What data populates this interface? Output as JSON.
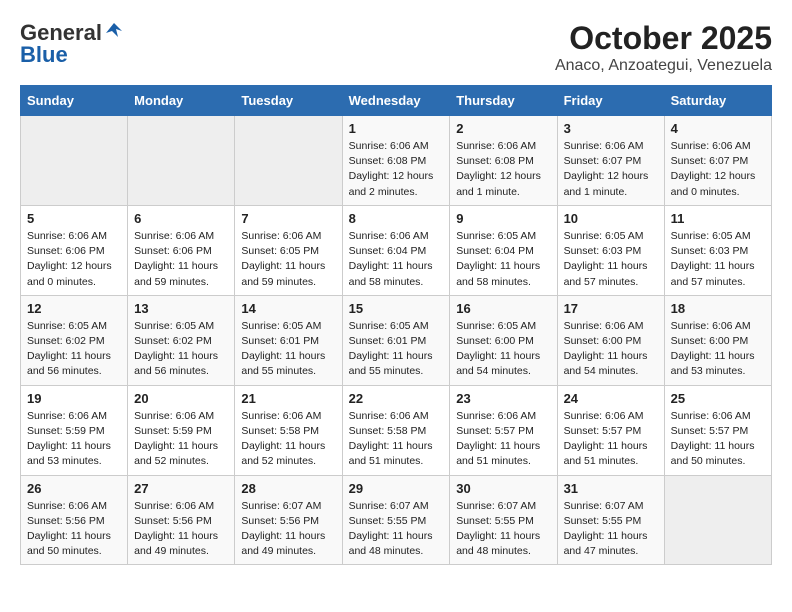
{
  "header": {
    "logo_general": "General",
    "logo_blue": "Blue",
    "title": "October 2025",
    "subtitle": "Anaco, Anzoategui, Venezuela"
  },
  "weekdays": [
    "Sunday",
    "Monday",
    "Tuesday",
    "Wednesday",
    "Thursday",
    "Friday",
    "Saturday"
  ],
  "weeks": [
    [
      {
        "day": "",
        "sunrise": "",
        "sunset": "",
        "daylight": ""
      },
      {
        "day": "",
        "sunrise": "",
        "sunset": "",
        "daylight": ""
      },
      {
        "day": "",
        "sunrise": "",
        "sunset": "",
        "daylight": ""
      },
      {
        "day": "1",
        "sunrise": "Sunrise: 6:06 AM",
        "sunset": "Sunset: 6:08 PM",
        "daylight": "Daylight: 12 hours and 2 minutes."
      },
      {
        "day": "2",
        "sunrise": "Sunrise: 6:06 AM",
        "sunset": "Sunset: 6:08 PM",
        "daylight": "Daylight: 12 hours and 1 minute."
      },
      {
        "day": "3",
        "sunrise": "Sunrise: 6:06 AM",
        "sunset": "Sunset: 6:07 PM",
        "daylight": "Daylight: 12 hours and 1 minute."
      },
      {
        "day": "4",
        "sunrise": "Sunrise: 6:06 AM",
        "sunset": "Sunset: 6:07 PM",
        "daylight": "Daylight: 12 hours and 0 minutes."
      }
    ],
    [
      {
        "day": "5",
        "sunrise": "Sunrise: 6:06 AM",
        "sunset": "Sunset: 6:06 PM",
        "daylight": "Daylight: 12 hours and 0 minutes."
      },
      {
        "day": "6",
        "sunrise": "Sunrise: 6:06 AM",
        "sunset": "Sunset: 6:06 PM",
        "daylight": "Daylight: 11 hours and 59 minutes."
      },
      {
        "day": "7",
        "sunrise": "Sunrise: 6:06 AM",
        "sunset": "Sunset: 6:05 PM",
        "daylight": "Daylight: 11 hours and 59 minutes."
      },
      {
        "day": "8",
        "sunrise": "Sunrise: 6:06 AM",
        "sunset": "Sunset: 6:04 PM",
        "daylight": "Daylight: 11 hours and 58 minutes."
      },
      {
        "day": "9",
        "sunrise": "Sunrise: 6:05 AM",
        "sunset": "Sunset: 6:04 PM",
        "daylight": "Daylight: 11 hours and 58 minutes."
      },
      {
        "day": "10",
        "sunrise": "Sunrise: 6:05 AM",
        "sunset": "Sunset: 6:03 PM",
        "daylight": "Daylight: 11 hours and 57 minutes."
      },
      {
        "day": "11",
        "sunrise": "Sunrise: 6:05 AM",
        "sunset": "Sunset: 6:03 PM",
        "daylight": "Daylight: 11 hours and 57 minutes."
      }
    ],
    [
      {
        "day": "12",
        "sunrise": "Sunrise: 6:05 AM",
        "sunset": "Sunset: 6:02 PM",
        "daylight": "Daylight: 11 hours and 56 minutes."
      },
      {
        "day": "13",
        "sunrise": "Sunrise: 6:05 AM",
        "sunset": "Sunset: 6:02 PM",
        "daylight": "Daylight: 11 hours and 56 minutes."
      },
      {
        "day": "14",
        "sunrise": "Sunrise: 6:05 AM",
        "sunset": "Sunset: 6:01 PM",
        "daylight": "Daylight: 11 hours and 55 minutes."
      },
      {
        "day": "15",
        "sunrise": "Sunrise: 6:05 AM",
        "sunset": "Sunset: 6:01 PM",
        "daylight": "Daylight: 11 hours and 55 minutes."
      },
      {
        "day": "16",
        "sunrise": "Sunrise: 6:05 AM",
        "sunset": "Sunset: 6:00 PM",
        "daylight": "Daylight: 11 hours and 54 minutes."
      },
      {
        "day": "17",
        "sunrise": "Sunrise: 6:06 AM",
        "sunset": "Sunset: 6:00 PM",
        "daylight": "Daylight: 11 hours and 54 minutes."
      },
      {
        "day": "18",
        "sunrise": "Sunrise: 6:06 AM",
        "sunset": "Sunset: 6:00 PM",
        "daylight": "Daylight: 11 hours and 53 minutes."
      }
    ],
    [
      {
        "day": "19",
        "sunrise": "Sunrise: 6:06 AM",
        "sunset": "Sunset: 5:59 PM",
        "daylight": "Daylight: 11 hours and 53 minutes."
      },
      {
        "day": "20",
        "sunrise": "Sunrise: 6:06 AM",
        "sunset": "Sunset: 5:59 PM",
        "daylight": "Daylight: 11 hours and 52 minutes."
      },
      {
        "day": "21",
        "sunrise": "Sunrise: 6:06 AM",
        "sunset": "Sunset: 5:58 PM",
        "daylight": "Daylight: 11 hours and 52 minutes."
      },
      {
        "day": "22",
        "sunrise": "Sunrise: 6:06 AM",
        "sunset": "Sunset: 5:58 PM",
        "daylight": "Daylight: 11 hours and 51 minutes."
      },
      {
        "day": "23",
        "sunrise": "Sunrise: 6:06 AM",
        "sunset": "Sunset: 5:57 PM",
        "daylight": "Daylight: 11 hours and 51 minutes."
      },
      {
        "day": "24",
        "sunrise": "Sunrise: 6:06 AM",
        "sunset": "Sunset: 5:57 PM",
        "daylight": "Daylight: 11 hours and 51 minutes."
      },
      {
        "day": "25",
        "sunrise": "Sunrise: 6:06 AM",
        "sunset": "Sunset: 5:57 PM",
        "daylight": "Daylight: 11 hours and 50 minutes."
      }
    ],
    [
      {
        "day": "26",
        "sunrise": "Sunrise: 6:06 AM",
        "sunset": "Sunset: 5:56 PM",
        "daylight": "Daylight: 11 hours and 50 minutes."
      },
      {
        "day": "27",
        "sunrise": "Sunrise: 6:06 AM",
        "sunset": "Sunset: 5:56 PM",
        "daylight": "Daylight: 11 hours and 49 minutes."
      },
      {
        "day": "28",
        "sunrise": "Sunrise: 6:07 AM",
        "sunset": "Sunset: 5:56 PM",
        "daylight": "Daylight: 11 hours and 49 minutes."
      },
      {
        "day": "29",
        "sunrise": "Sunrise: 6:07 AM",
        "sunset": "Sunset: 5:55 PM",
        "daylight": "Daylight: 11 hours and 48 minutes."
      },
      {
        "day": "30",
        "sunrise": "Sunrise: 6:07 AM",
        "sunset": "Sunset: 5:55 PM",
        "daylight": "Daylight: 11 hours and 48 minutes."
      },
      {
        "day": "31",
        "sunrise": "Sunrise: 6:07 AM",
        "sunset": "Sunset: 5:55 PM",
        "daylight": "Daylight: 11 hours and 47 minutes."
      },
      {
        "day": "",
        "sunrise": "",
        "sunset": "",
        "daylight": ""
      }
    ]
  ]
}
